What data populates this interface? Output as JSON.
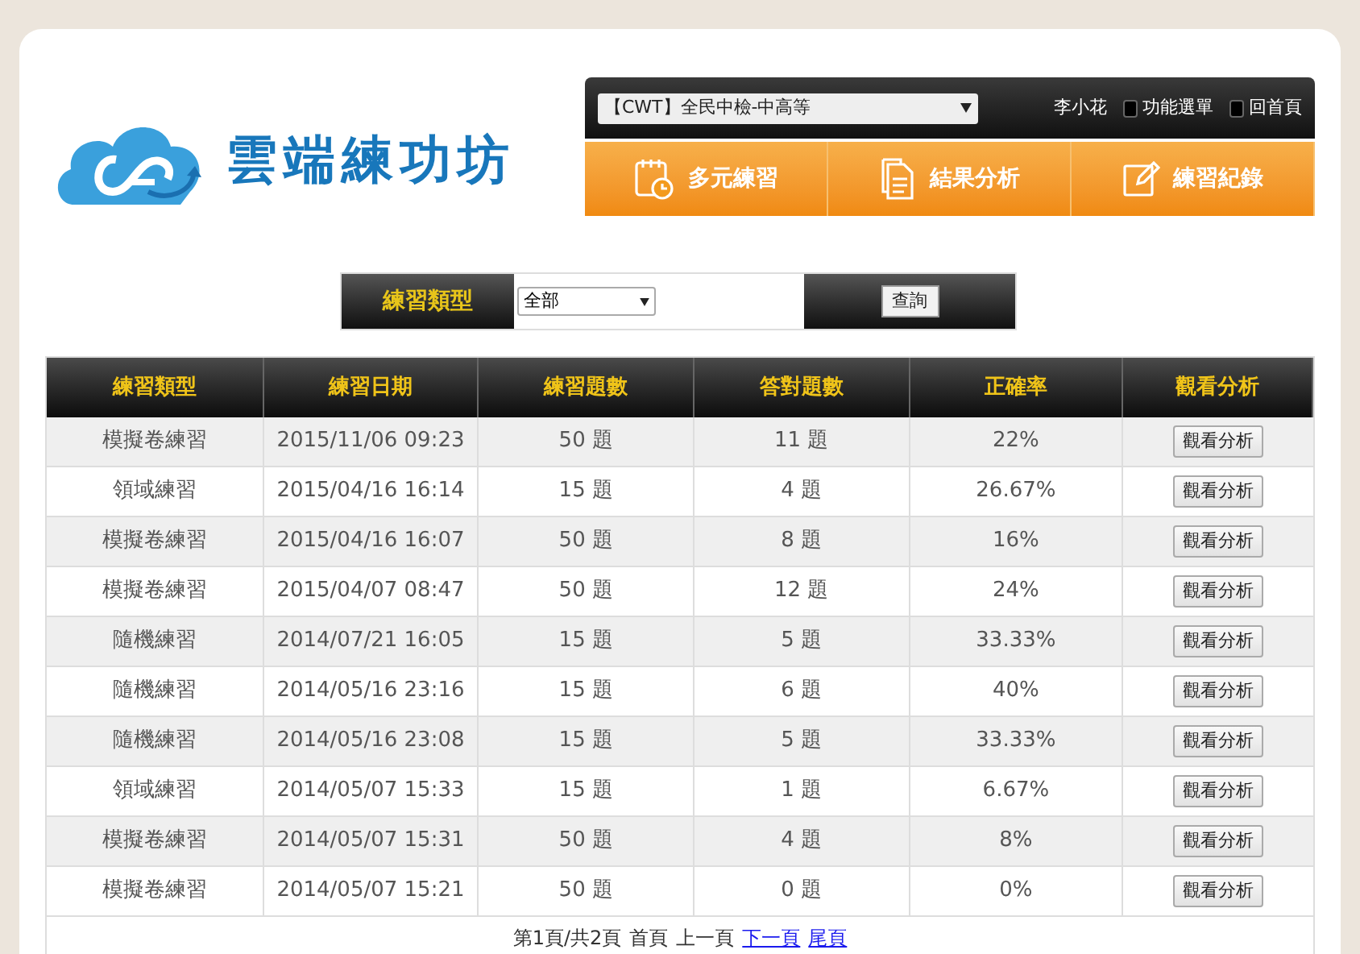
{
  "logo": {
    "title": "雲端練功坊"
  },
  "topbar": {
    "exam_select": "【CWT】全民中檢-中高等",
    "user": "李小花",
    "links": [
      "功能選單",
      "回首頁"
    ]
  },
  "nav": [
    {
      "label": "多元練習",
      "kind": "calendar"
    },
    {
      "label": "結果分析",
      "kind": "document"
    },
    {
      "label": "練習紀錄",
      "kind": "pencil"
    }
  ],
  "filter": {
    "label": "練習類型",
    "select": "全部",
    "button": "查詢"
  },
  "table": {
    "columns": [
      "練習類型",
      "練習日期",
      "練習題數",
      "答對題數",
      "正確率",
      "觀看分析"
    ],
    "rows": [
      [
        "模擬卷練習",
        "2015/11/06 09:23",
        "50 題",
        "11 題",
        "22%",
        "觀看分析"
      ],
      [
        "領域練習",
        "2015/04/16 16:14",
        "15 題",
        "4 題",
        "26.67%",
        "觀看分析"
      ],
      [
        "模擬卷練習",
        "2015/04/16 16:07",
        "50 題",
        "8 題",
        "16%",
        "觀看分析"
      ],
      [
        "模擬卷練習",
        "2015/04/07 08:47",
        "50 題",
        "12 題",
        "24%",
        "觀看分析"
      ],
      [
        "隨機練習",
        "2014/07/21 16:05",
        "15 題",
        "5 題",
        "33.33%",
        "觀看分析"
      ],
      [
        "隨機練習",
        "2014/05/16 23:16",
        "15 題",
        "6 題",
        "40%",
        "觀看分析"
      ],
      [
        "隨機練習",
        "2014/05/16 23:08",
        "15 題",
        "5 題",
        "33.33%",
        "觀看分析"
      ],
      [
        "領域練習",
        "2014/05/07 15:33",
        "15 題",
        "1 題",
        "6.67%",
        "觀看分析"
      ],
      [
        "模擬卷練習",
        "2014/05/07 15:31",
        "50 題",
        "4 題",
        "8%",
        "觀看分析"
      ],
      [
        "模擬卷練習",
        "2014/05/07 15:21",
        "50 題",
        "0 題",
        "0%",
        "觀看分析"
      ]
    ]
  },
  "pagination": [
    {
      "label": "第1頁/共2頁",
      "kind": "text"
    },
    {
      "label": "首頁",
      "kind": "text"
    },
    {
      "label": "上一頁",
      "kind": "text"
    },
    {
      "label": "下一頁",
      "kind": "link"
    },
    {
      "label": "尾頁",
      "kind": "link"
    }
  ]
}
